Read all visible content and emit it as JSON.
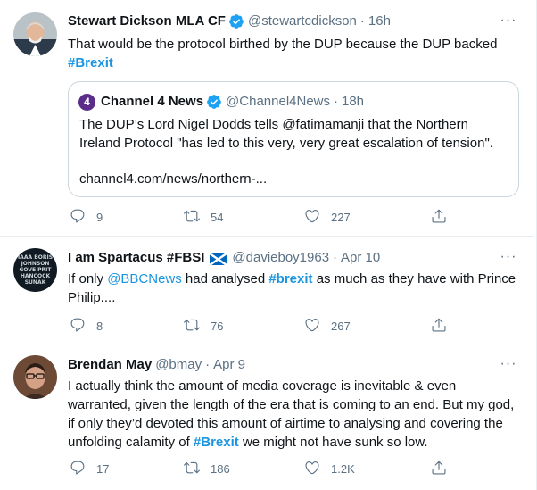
{
  "tweets": [
    {
      "name": "Stewart Dickson MLA CF",
      "handle": "@stewartcdickson",
      "time": "16h",
      "text_before": "That would be the protocol birthed by the DUP because the DUP backed ",
      "hashtag": "#Brexit",
      "quote": {
        "avatar_glyph": "4",
        "name": "Channel 4 News",
        "handle": "@Channel4News",
        "time": "18h",
        "text": "The DUP’s Lord Nigel Dodds tells @fatimamanji that the Northern Ireland Protocol \"has led to this very, very great escalation of tension\".",
        "link": "channel4.com/news/northern-..."
      },
      "replies": "9",
      "retweets": "54",
      "likes": "227"
    },
    {
      "name": "I am Spartacus #FBSI",
      "handle": "@davieboy1963",
      "time": "Apr 10",
      "text_1": "If only ",
      "mention": "@BBCNews",
      "text_2": " had analysed ",
      "hashtag": "#brexit",
      "text_3": " as much as they have with Prince Philip....",
      "replies": "8",
      "retweets": "76",
      "likes": "267"
    },
    {
      "name": "Brendan May",
      "handle": "@bmay",
      "time": "Apr 9",
      "text_before": "I actually think the amount of media coverage is inevitable & even warranted, given the length of the era that is coming to an end. But my god, if only they’d devoted this amount of airtime to analysing and covering the unfolding calamity of ",
      "hashtag": "#Brexit",
      "text_after": " we might not have sunk so low.",
      "replies": "17",
      "retweets": "186",
      "likes": "1.2K"
    }
  ],
  "separator": "·",
  "more_glyph": "···",
  "colors": {
    "accent": "#1b95e0",
    "muted": "#5b7083",
    "border": "#e6ecf0",
    "verified": "#1da1f2"
  }
}
